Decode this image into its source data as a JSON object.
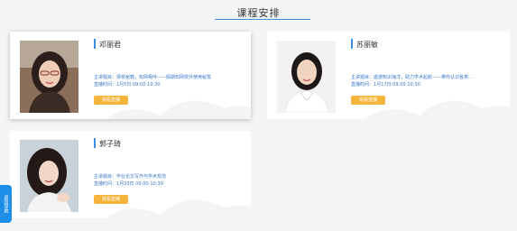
{
  "section": {
    "title": "课程安排"
  },
  "sidebar_tab": {
    "label": "返回导航"
  },
  "labels": {
    "topic": "主讲题目：",
    "time": "直播时间："
  },
  "teachers": [
    {
      "name": "邓丽君",
      "topic": "择校秘籍，知网相伴——假期知网校外使用秘笈",
      "time": "1月5日 09:00-10:30",
      "button": "观看直播"
    },
    {
      "name": "苏丽敏",
      "topic": "遨游知识海洋，助力学术起航——带你认识各类...",
      "time": "1月17日 09:00-10:30",
      "button": "观看直播"
    },
    {
      "name": "郭子琦",
      "topic": "毕业论文写作与学术规范",
      "time": "1月20日 09:00-10:30",
      "button": "观看直播"
    }
  ],
  "colors": {
    "accent": "#3a8ee6",
    "button": "#f5b53a",
    "side_tab": "#1e8fe8"
  }
}
